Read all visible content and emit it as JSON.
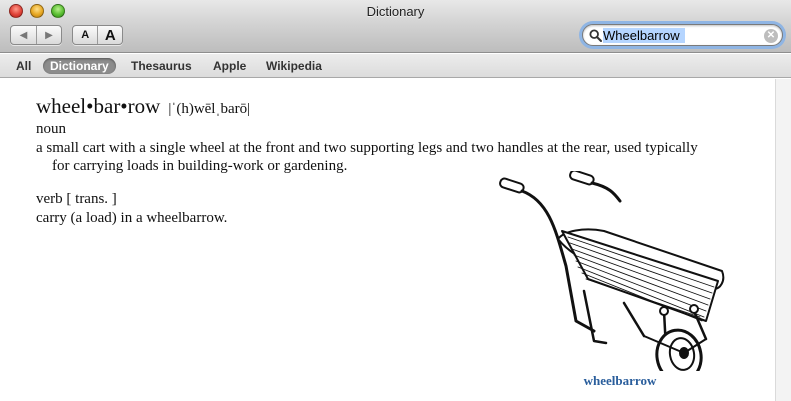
{
  "window": {
    "title": "Dictionary"
  },
  "toolbar": {
    "back_glyph": "◀",
    "forward_glyph": "▶",
    "font_smaller_label": "A",
    "font_larger_label": "A"
  },
  "search": {
    "value": "Wheelbarrow",
    "clear_glyph": "✕"
  },
  "scope": {
    "items": [
      {
        "label": "All",
        "active": false
      },
      {
        "label": "Dictionary",
        "active": true
      },
      {
        "label": "Thesaurus",
        "active": false
      },
      {
        "label": "Apple",
        "active": false
      },
      {
        "label": "Wikipedia",
        "active": false
      }
    ]
  },
  "entry": {
    "headword": "wheel•bar•row",
    "pronunciation": "|ˈ(h)wēlˌbarō|",
    "senses": [
      {
        "pos": "noun",
        "definition": "a small cart with a single wheel at the front and two supporting legs and two handles at the rear, used typically for carrying loads in building-work or gardening."
      },
      {
        "pos": "verb [ trans. ]",
        "definition": "carry (a load) in a wheelbarrow."
      }
    ],
    "illustration_caption": "wheelbarrow"
  },
  "colors": {
    "caption": "#2a5e9c",
    "scope_active_bg": "#8c8c8c",
    "search_focus_ring": "#8fb5e4"
  },
  "icons": [
    "close-button",
    "minimize-button",
    "zoom-button",
    "back-arrow-icon",
    "forward-arrow-icon",
    "search-icon",
    "clear-icon"
  ]
}
